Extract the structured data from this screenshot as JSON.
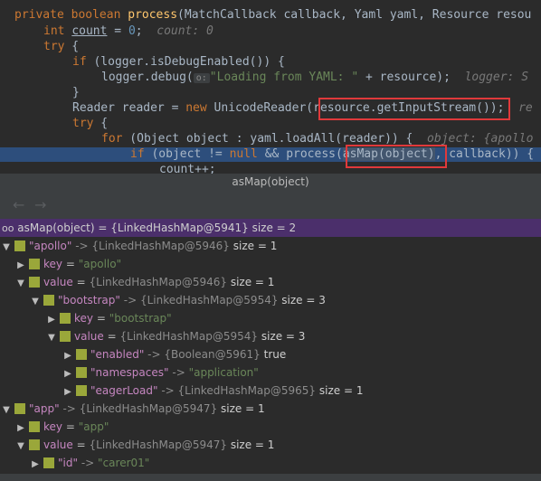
{
  "code": {
    "line1": {
      "kw": "private",
      "type": "boolean",
      "fn": "process",
      "rest": "(MatchCallback callback, Yaml yaml, Resource resou"
    },
    "line2": {
      "kw": "int",
      "var": "count",
      "mid": " = ",
      "num": "0",
      "end": ";",
      "hint": "count: 0"
    },
    "line3": {
      "kw": "try",
      "rest": " {"
    },
    "line4": {
      "kw": "if",
      "rest": " (logger.isDebugEnabled()) {"
    },
    "line5": {
      "pre": "logger.debug(",
      "pill": "o:",
      "str": "\"Loading from YAML: \"",
      "post": " + resource);",
      "hint": "logger: S"
    },
    "line6": {
      "text": "}"
    },
    "line7": {
      "pre": "Reader reader = ",
      "kw": "new",
      "mid": " UnicodeReader(",
      "boxed": "resource.getInputStream()",
      "post": ");",
      "hint": "re"
    },
    "line8": {
      "kw": "try",
      "rest": " {"
    },
    "line9": {
      "kw": "for",
      "rest": " (Object object : yaml.loadAll(reader)) {",
      "hint": "object: {apollo"
    },
    "line10": {
      "kw": "if",
      "pre": " (object != ",
      "null": "null",
      "mid": " && process(",
      "boxed": "asMap(object)",
      "post": ", callback)) {"
    },
    "line11": {
      "text": "count++;"
    }
  },
  "popup": {
    "title": "asMap(object)"
  },
  "toolbar": {
    "back": "←",
    "forward": "→"
  },
  "tree": {
    "root": "asMap(object) = {LinkedHashMap@5941}  size = 2",
    "rows": [
      {
        "key": "\"apollo\"",
        "arrow": "->",
        "type": "{LinkedHashMap@5946}",
        "size": "size = 1"
      },
      {
        "key": "key",
        "eq": "=",
        "val": "\"apollo\""
      },
      {
        "key": "value",
        "eq": "=",
        "type": "{LinkedHashMap@5946}",
        "size": "size = 1"
      },
      {
        "key": "\"bootstrap\"",
        "arrow": "->",
        "type": "{LinkedHashMap@5954}",
        "size": "size = 3"
      },
      {
        "key": "key",
        "eq": "=",
        "val": "\"bootstrap\""
      },
      {
        "key": "value",
        "eq": "=",
        "type": "{LinkedHashMap@5954}",
        "size": "size = 3"
      },
      {
        "key": "\"enabled\"",
        "arrow": "->",
        "type": "{Boolean@5961}",
        "size": "true"
      },
      {
        "key": "\"namespaces\"",
        "arrow": "->",
        "val": "\"application\""
      },
      {
        "key": "\"eagerLoad\"",
        "arrow": "->",
        "type": "{LinkedHashMap@5965}",
        "size": "size = 1"
      },
      {
        "key": "\"app\"",
        "arrow": "->",
        "type": "{LinkedHashMap@5947}",
        "size": "size = 1"
      },
      {
        "key": "key",
        "eq": "=",
        "val": "\"app\""
      },
      {
        "key": "value",
        "eq": "=",
        "type": "{LinkedHashMap@5947}",
        "size": "size = 1"
      },
      {
        "key": "\"id\"",
        "arrow": "->",
        "val": "\"carer01\""
      }
    ]
  },
  "colors": {
    "highlight": "#2d4e7c",
    "box": "#e0393b",
    "root_row": "#4b2f6b",
    "field_icon": "#9aa73a"
  }
}
